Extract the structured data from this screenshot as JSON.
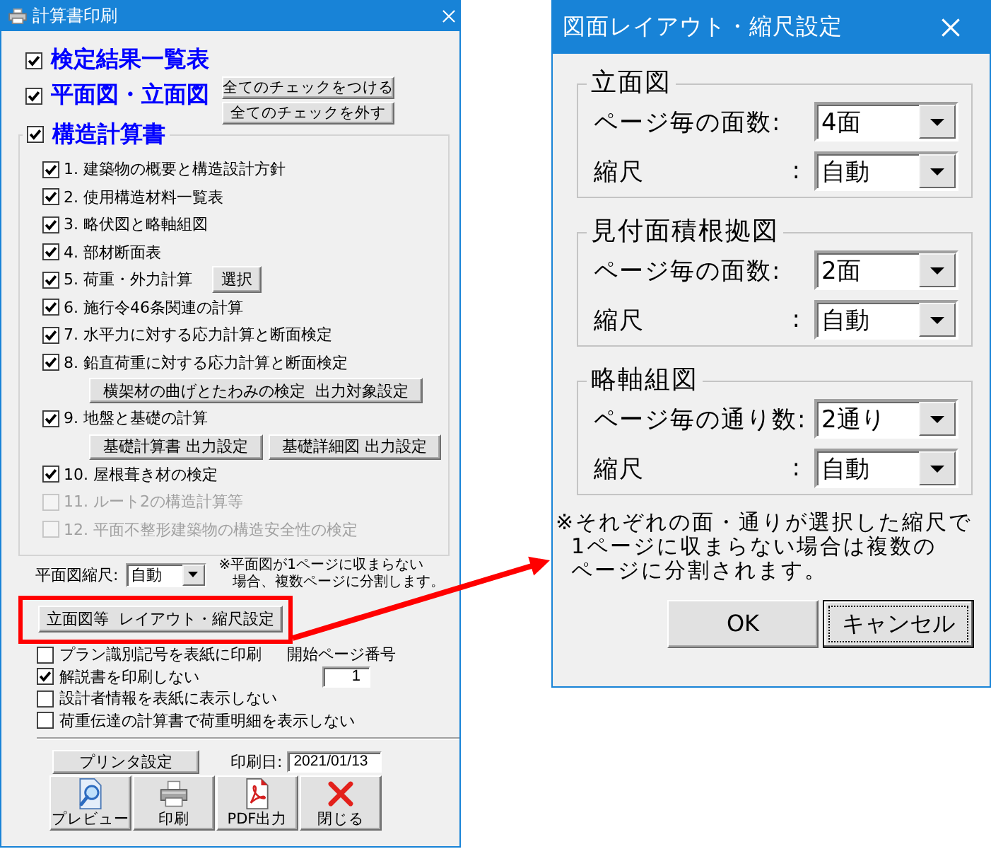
{
  "print_dialog": {
    "title": "計算書印刷",
    "top_options": [
      {
        "label": "検定結果一覧表",
        "checked": true
      },
      {
        "label": "平面図・立面図",
        "checked": true
      }
    ],
    "check_buttons": [
      "全てのチェックをつける",
      "全てのチェックを外す"
    ],
    "structure_group": {
      "label": "構造計算書",
      "checked": true,
      "items": [
        {
          "label": "1. 建築物の概要と構造設計方針",
          "checked": true,
          "disabled": false
        },
        {
          "label": "2. 使用構造材料一覧表",
          "checked": true,
          "disabled": false
        },
        {
          "label": "3. 略伏図と略軸組図",
          "checked": true,
          "disabled": false
        },
        {
          "label": "4. 部材断面表",
          "checked": true,
          "disabled": false
        },
        {
          "label": "5. 荷重・外力計算",
          "checked": true,
          "disabled": false,
          "inline_button": "選択"
        },
        {
          "label": "6. 施行令46条関連の計算",
          "checked": true,
          "disabled": false
        },
        {
          "label": "7. 水平力に対する応力計算と断面検定",
          "checked": true,
          "disabled": false
        },
        {
          "label": "8. 鉛直荷重に対する応力計算と断面検定",
          "checked": true,
          "disabled": false,
          "sub_buttons": [
            "横架材の曲げとたわみの検定  出力対象設定"
          ]
        },
        {
          "label": "9. 地盤と基礎の計算",
          "checked": true,
          "disabled": false,
          "sub_buttons": [
            "基礎計算書 出力設定",
            "基礎詳細図 出力設定"
          ]
        },
        {
          "label": "10. 屋根葺き材の検定",
          "checked": true,
          "disabled": false
        },
        {
          "label": "11. ルート2の構造計算等",
          "checked": false,
          "disabled": true
        },
        {
          "label": "12. 平面不整形建築物の構造安全性の検定",
          "checked": false,
          "disabled": true
        }
      ]
    },
    "plan_scale": {
      "label": "平面図縮尺:",
      "value": "自動",
      "note_lines": [
        "※平面図が1ページに収まらない",
        "場合、複数ページに分割します。"
      ]
    },
    "layout_button": {
      "label": "立面図等  レイアウト・縮尺設定",
      "highlighted": true
    },
    "options": [
      {
        "label": "プラン識別記号を表紙に印刷",
        "checked": false
      },
      {
        "label": "解説書を印刷しない",
        "checked": true
      },
      {
        "label": "設計者情報を表紙に表示しない",
        "checked": false
      },
      {
        "label": "荷重伝達の計算書で荷重明細を表示しない",
        "checked": false
      }
    ],
    "start_page": {
      "label": "開始ページ番号",
      "value": "1"
    },
    "printer_button": "プリンタ設定",
    "print_date": {
      "label": "印刷日:",
      "value": "2021/01/13"
    },
    "actions": [
      {
        "kind": "preview",
        "label": "プレビュー"
      },
      {
        "kind": "print",
        "label": "印刷"
      },
      {
        "kind": "pdf",
        "label": "PDF出力"
      },
      {
        "kind": "close",
        "label": "閉じる"
      }
    ]
  },
  "layout_dialog": {
    "title": "図面レイアウト・縮尺設定",
    "groups": [
      {
        "title": "立面図",
        "rows": [
          {
            "label": "ページ毎の面数:",
            "value": "4面"
          },
          {
            "label": "縮尺",
            "colon": ":",
            "value": "自動"
          }
        ]
      },
      {
        "title": "見付面積根拠図",
        "rows": [
          {
            "label": "ページ毎の面数:",
            "value": "2面"
          },
          {
            "label": "縮尺",
            "colon": ":",
            "value": "自動"
          }
        ]
      },
      {
        "title": "略軸組図",
        "rows": [
          {
            "label": "ページ毎の通り数:",
            "value": "2通り"
          },
          {
            "label": "縮尺",
            "colon": ":",
            "value": "自動"
          }
        ]
      }
    ],
    "note_lines": [
      "※それぞれの面・通りが選択した縮尺で",
      "1ページに収まらない場合は複数の",
      "ページに分割されます。"
    ],
    "buttons": [
      {
        "label": "OK",
        "focused": false
      },
      {
        "label": "キャンセル",
        "focused": true
      }
    ]
  }
}
